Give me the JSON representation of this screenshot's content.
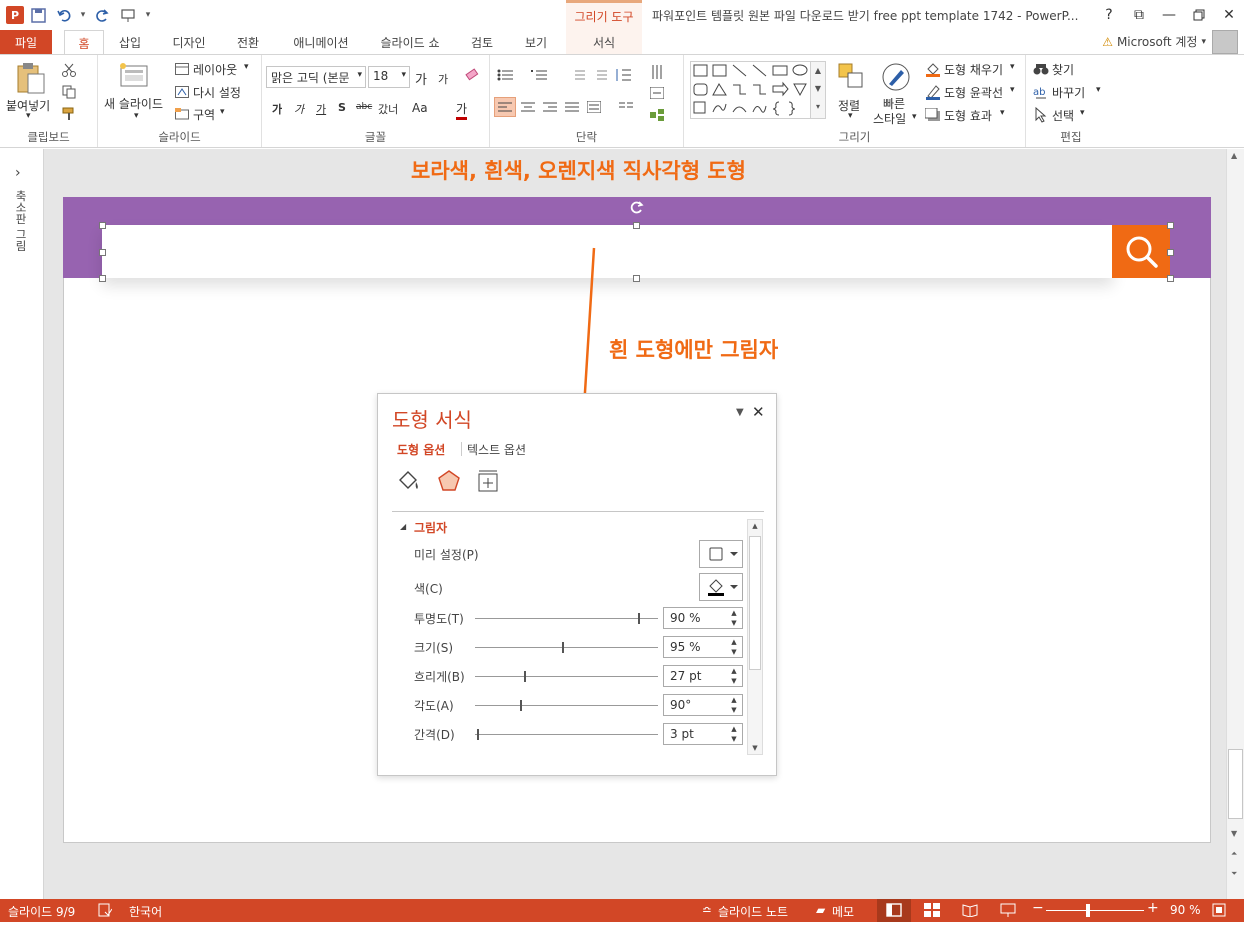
{
  "app": {
    "title": "파워포인트 템플릿 원본 파일 다운로드 받기 free ppt template 1742 - PowerP...",
    "context_tab_header": "그리기 도구",
    "help": "?",
    "restore": "⧉",
    "minimize": "—",
    "close": "✕"
  },
  "qat": {
    "logo": "P",
    "undo_dd": "▾",
    "customize": "▾"
  },
  "tabs": [
    {
      "label": "파일"
    },
    {
      "label": "홈"
    },
    {
      "label": "삽입"
    },
    {
      "label": "디자인"
    },
    {
      "label": "전환"
    },
    {
      "label": "애니메이션"
    },
    {
      "label": "슬라이드 쇼"
    },
    {
      "label": "검토"
    },
    {
      "label": "보기"
    },
    {
      "label": "서식"
    }
  ],
  "account": {
    "warning": "⚠",
    "label": "Microsoft 계정",
    "dd": "▾"
  },
  "ribbon": {
    "clipboard": {
      "label": "클립보드",
      "paste": "붙여넣기",
      "paste_dd": "▾"
    },
    "slides": {
      "label": "슬라이드",
      "new_slide": "새 슬라이드",
      "new_slide_dd": "▾",
      "layout": "레이아웃",
      "reset": "다시 설정",
      "section": "구역",
      "dd": "▾"
    },
    "font": {
      "label": "글꼴",
      "font_name": "맑은 고딕 (본문",
      "font_size": "18",
      "dd": "▾",
      "grow": "가",
      "shrink": "가",
      "bold": "가",
      "italic": "가",
      "underline": "가",
      "shadow": "S",
      "strike": "abc",
      "spacing": "갔너",
      "case": "Aa",
      "color": "가"
    },
    "paragraph": {
      "label": "단락"
    },
    "drawing": {
      "label": "그리기",
      "arrange": "정렬",
      "quick_styles_1": "빠른",
      "quick_styles_2": "스타일",
      "fill": "도형 채우기",
      "outline": "도형 윤곽선",
      "effects": "도형 효과",
      "dd": "▾"
    },
    "editing": {
      "label": "편집",
      "find": "찾기",
      "replace": "바꾸기",
      "select": "선택",
      "dd": "▾"
    }
  },
  "left_pane": {
    "label": "축소판 그림",
    "expand": "›"
  },
  "slide": {
    "annotation_title": "보라색, 흰색, 오렌지색 직사각형 도형",
    "annotation_shadow": "흰 도형에만 그림자",
    "colors": {
      "purple": "#9763b0",
      "orange": "#f06a14",
      "white": "#ffffff"
    }
  },
  "format_pane": {
    "title": "도형 서식",
    "tab_shape": "도형 옵션",
    "tab_text": "텍스트 옵션",
    "section": "그림자",
    "preset_label": "미리 설정(P)",
    "color_label": "색(C)",
    "transparency_label": "투명도(T)",
    "transparency_value": "90 %",
    "transparency_fraction": 0.9,
    "size_label": "크기(S)",
    "size_value": "95 %",
    "size_fraction": 0.48,
    "blur_label": "흐리게(B)",
    "blur_value": "27 pt",
    "blur_fraction": 0.27,
    "angle_label": "각도(A)",
    "angle_value": "90°",
    "angle_fraction": 0.25,
    "distance_label": "간격(D)",
    "distance_value": "3 pt",
    "distance_fraction": 0.01
  },
  "status": {
    "slide": "슬라이드 9/9",
    "lang": "한국어",
    "notes": "슬라이드 노트",
    "comments": "메모",
    "zoom": "90 %",
    "zoom_minus": "−",
    "zoom_plus": "+"
  }
}
